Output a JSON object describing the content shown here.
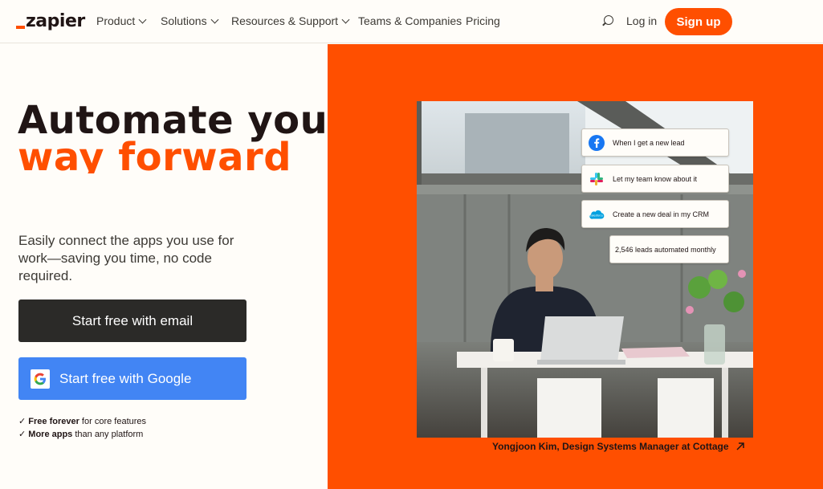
{
  "header": {
    "logo_text": "zapier",
    "nav": [
      {
        "label": "Product",
        "dropdown": true
      },
      {
        "label": "Solutions",
        "dropdown": true
      },
      {
        "label": "Resources & Support",
        "dropdown": true
      },
      {
        "label": "Teams & Companies",
        "dropdown": false
      },
      {
        "label": "Pricing",
        "dropdown": false
      }
    ],
    "login_label": "Log in",
    "signup_label": "Sign up"
  },
  "hero": {
    "headline_line1": "Automate your",
    "headline_line2": "way forward",
    "subtext": "Easily connect the apps you use for work—saving you time, no code required.",
    "email_button": "Start free with email",
    "google_button": "Start free with Google",
    "checks": [
      {
        "bold": "Free forever",
        "rest": " for core features"
      },
      {
        "bold": "More apps",
        "rest": " than any platform"
      }
    ]
  },
  "image_panel": {
    "cards": [
      {
        "icon": "facebook-icon",
        "text": "When I get a new lead"
      },
      {
        "icon": "slack-icon",
        "text": "Let my team know about it"
      },
      {
        "icon": "salesforce-icon",
        "text": "Create a new deal in my CRM"
      },
      {
        "icon": "",
        "text": "2,546 leads automated monthly"
      }
    ],
    "caption": "Yongjoon Kim, Design Systems Manager at Cottage"
  },
  "colors": {
    "brand_orange": "#ff4f00",
    "dark_button": "#2b2a28",
    "google_blue": "#4285f4",
    "background": "#fffdf9"
  }
}
